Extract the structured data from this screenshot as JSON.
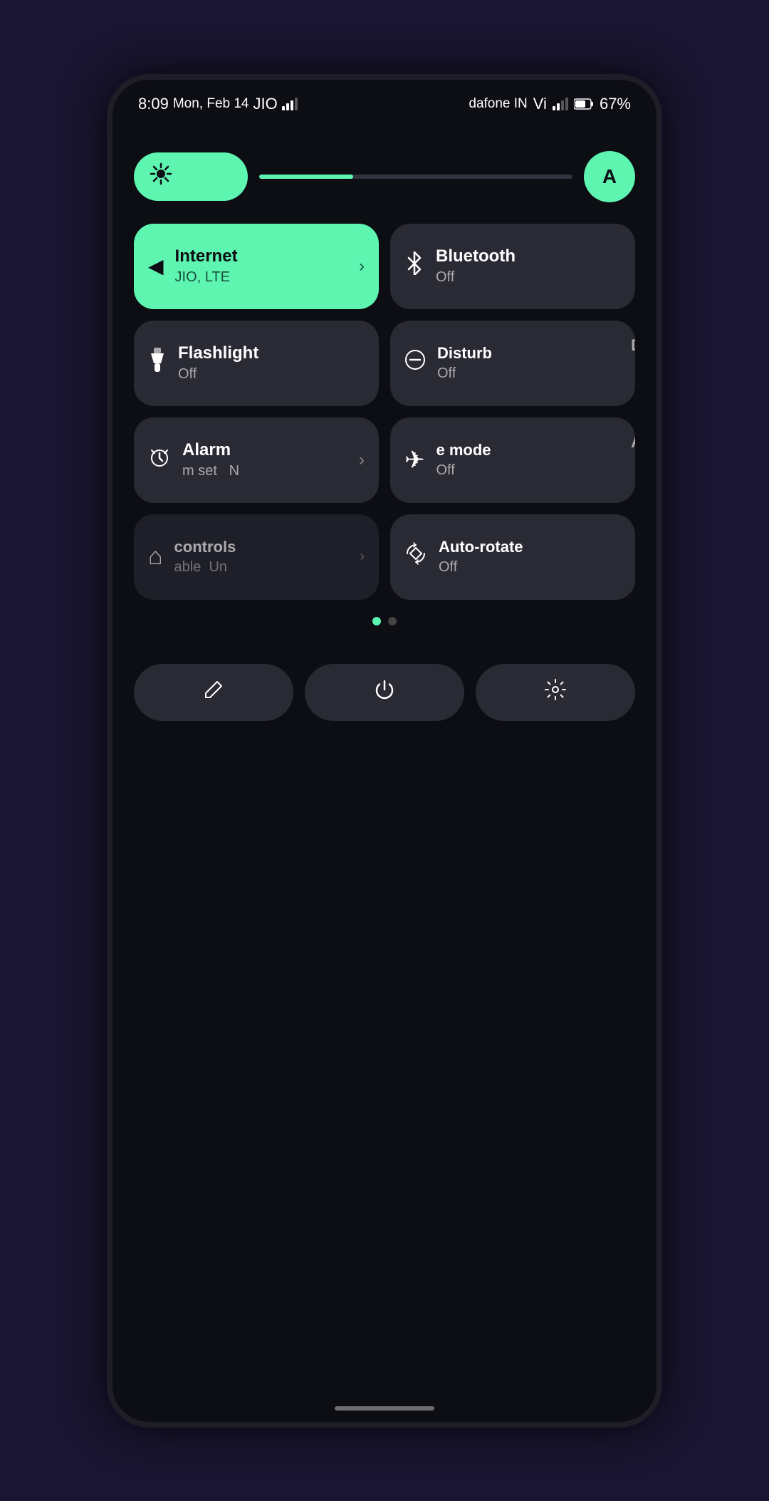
{
  "statusBar": {
    "time": "8:09",
    "date": "Mon, Feb 14",
    "carrier1": "JIO",
    "carrier2": "dafone IN",
    "carrier3": "Vi",
    "battery": "67%"
  },
  "brightness": {
    "icon": "☀",
    "autoIcon": "A",
    "level": 30
  },
  "tiles": [
    {
      "id": "internet",
      "active": true,
      "icon": "◄",
      "title": "Internet",
      "subtitle": "JIO, LTE",
      "hasChevron": true,
      "colspan": 1
    },
    {
      "id": "bluetooth",
      "active": false,
      "icon": "✱",
      "title": "Bluetooth",
      "subtitle": "Off",
      "hasChevron": false
    },
    {
      "id": "flashlight",
      "active": false,
      "icon": "🔦",
      "title": "Flashlight",
      "subtitle": "Off",
      "hasChevron": false
    },
    {
      "id": "disturb",
      "active": false,
      "icon": "⊖",
      "title": "Disturb",
      "subtitle": "Off",
      "hasChevron": false,
      "partial": true
    },
    {
      "id": "alarm",
      "active": false,
      "icon": "⏰",
      "title": "Alarm",
      "subtitle": "m set   N",
      "hasChevron": true
    },
    {
      "id": "airplane",
      "active": false,
      "icon": "✈",
      "title": "e mode",
      "subtitle": "Off",
      "hasChevron": false,
      "partial": true
    },
    {
      "id": "homecontrols",
      "active": false,
      "icon": "⌂",
      "title": "controls",
      "subtitle": "able   Un",
      "hasChevron": true,
      "partial": true
    },
    {
      "id": "autorotate",
      "active": false,
      "icon": "⟳",
      "title": "Auto-rotate",
      "subtitle": "Off",
      "hasChevron": false
    }
  ],
  "pageDots": [
    {
      "active": true
    },
    {
      "active": false
    }
  ],
  "bottomButtons": [
    {
      "id": "edit",
      "icon": "✏"
    },
    {
      "id": "power",
      "icon": "⏻"
    },
    {
      "id": "settings",
      "icon": "⚙"
    }
  ]
}
